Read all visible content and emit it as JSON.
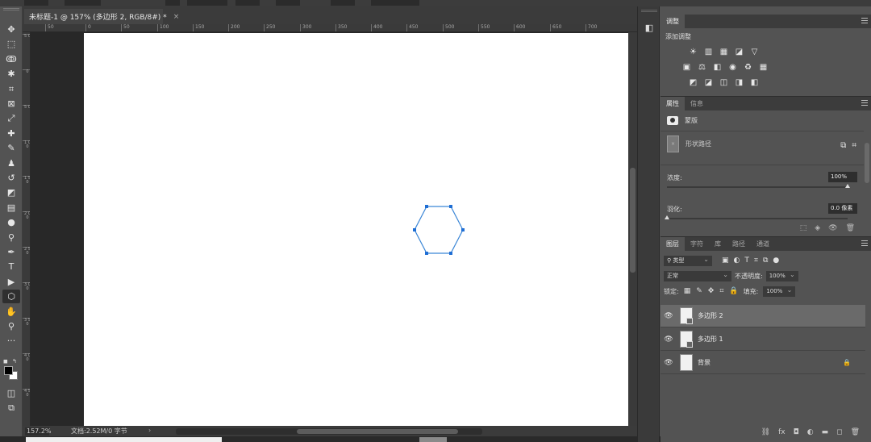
{
  "document": {
    "tab_title": "未标题-1 @ 157% (多边形 2, RGB/8#) *",
    "close_glyph": "×"
  },
  "ruler": {
    "h_labels": [
      "50",
      "0",
      "50",
      "100",
      "150",
      "200",
      "250",
      "300",
      "350",
      "400",
      "450",
      "500",
      "550",
      "600",
      "650",
      "700"
    ],
    "v_labels": [
      "5 0",
      "0",
      "5 0",
      "1 0 0",
      "1 5 0",
      "2 0 0",
      "2 5 0",
      "3 0 0",
      "3 5 0",
      "4 0 0",
      "4 5 0"
    ]
  },
  "status": {
    "zoom": "157.2%",
    "doc_info": "文档:2.52M/0 字节",
    "arrow": "›"
  },
  "tools": [
    {
      "name": "move-tool",
      "glyph": "✥"
    },
    {
      "name": "marquee-tool",
      "glyph": "⬚"
    },
    {
      "name": "lasso-tool",
      "glyph": "ↂ"
    },
    {
      "name": "magic-wand-tool",
      "glyph": "✱"
    },
    {
      "name": "crop-tool",
      "glyph": "⌗"
    },
    {
      "name": "frame-tool",
      "glyph": "⊠"
    },
    {
      "name": "eyedropper-tool",
      "glyph": "⤢"
    },
    {
      "name": "healing-brush-tool",
      "glyph": "✚"
    },
    {
      "name": "brush-tool",
      "glyph": "✎"
    },
    {
      "name": "clone-stamp-tool",
      "glyph": "♟"
    },
    {
      "name": "history-brush-tool",
      "glyph": "↺"
    },
    {
      "name": "eraser-tool",
      "glyph": "◩"
    },
    {
      "name": "gradient-tool",
      "glyph": "▤"
    },
    {
      "name": "blur-tool",
      "glyph": "●"
    },
    {
      "name": "dodge-tool",
      "glyph": "⚲"
    },
    {
      "name": "pen-tool",
      "glyph": "✒"
    },
    {
      "name": "type-tool",
      "glyph": "T"
    },
    {
      "name": "path-selection-tool",
      "glyph": "▶"
    },
    {
      "name": "polygon-tool",
      "glyph": "⬡"
    },
    {
      "name": "hand-tool",
      "glyph": "✋"
    },
    {
      "name": "zoom-tool",
      "glyph": "⚲"
    },
    {
      "name": "more-tools",
      "glyph": "···"
    }
  ],
  "adjustments_panel": {
    "tab": "调整",
    "subtitle": "添加调整",
    "row1": [
      "☀",
      "▥",
      "▦",
      "◪",
      "▽"
    ],
    "row2": [
      "▣",
      "⚖",
      "◧",
      "◉",
      "♻",
      "▦"
    ],
    "row3": [
      "◩",
      "◪",
      "◫",
      "◨",
      "◧"
    ]
  },
  "properties_panel": {
    "tabs": [
      "属性",
      "信息"
    ],
    "subtitle": "蒙版",
    "shape_label": "形状路径",
    "density_label": "浓度:",
    "density_value": "100%",
    "feather_label": "羽化:",
    "feather_value": "0.0 像素",
    "density_level": 1.0,
    "feather_level": 0.0
  },
  "layers_panel": {
    "tabs": [
      "图层",
      "字符",
      "库",
      "路径",
      "通道"
    ],
    "filter": "类型",
    "blend_mode": "正常",
    "opacity_label": "不透明度:",
    "opacity_value": "100%",
    "lock_label": "锁定:",
    "fill_label": "填充:",
    "fill_value": "100%",
    "layers": [
      {
        "name": "多边形 2",
        "selected": true
      },
      {
        "name": "多边形 1",
        "selected": false
      },
      {
        "name": "背景",
        "selected": false
      }
    ],
    "footer": [
      "⛓",
      "fx",
      "◘",
      "◐",
      "▬",
      "◻",
      "🗑"
    ]
  },
  "colors": {
    "selection_blue": "#1f6ed4",
    "canvas": "#ffffff"
  }
}
